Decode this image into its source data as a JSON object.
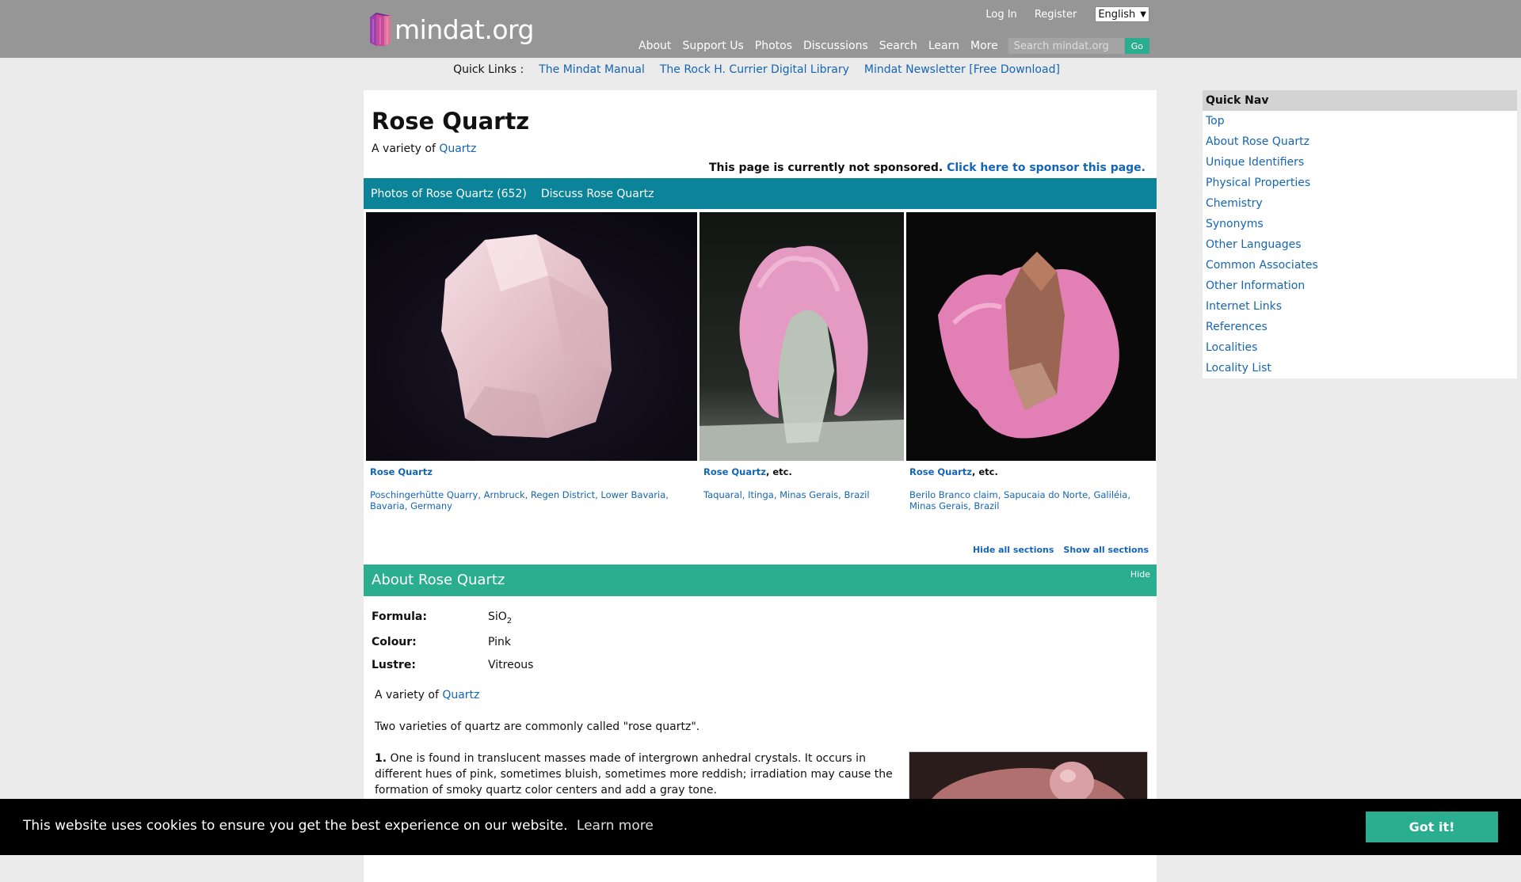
{
  "header": {
    "logo_text": "mindat.org",
    "login": "Log In",
    "register": "Register",
    "language": "English",
    "nav": [
      "About",
      "Support Us",
      "Photos",
      "Discussions",
      "Search",
      "Learn",
      "More"
    ],
    "search_placeholder": "Search mindat.org",
    "go": "Go"
  },
  "quick_links": {
    "label": "Quick Links :",
    "items": [
      "The Mindat Manual",
      "The Rock H. Currier Digital Library",
      "Mindat Newsletter [Free Download]"
    ]
  },
  "page": {
    "title": "Rose Quartz",
    "variety_prefix": "A variety of",
    "variety_link": "Quartz",
    "sponsor_text": "This page is currently not sponsored.",
    "sponsor_link": "Click here to sponsor this page.",
    "tabs": [
      "Photos of Rose Quartz (652)",
      "Discuss Rose Quartz"
    ]
  },
  "gallery": [
    {
      "name": "Rose Quartz",
      "suffix": "",
      "locality": "Poschingerhütte Quarry, Arnbruck, Regen District, Lower Bavaria, Bavaria, Germany"
    },
    {
      "name": "Rose Quartz",
      "suffix": ", etc.",
      "locality": "Taquaral, Itinga, Minas Gerais, Brazil"
    },
    {
      "name": "Rose Quartz",
      "suffix": ", etc.",
      "locality": "Berilo Branco claim, Sapucaia do Norte, Galiléia, Minas Gerais, Brazil"
    }
  ],
  "section_controls": {
    "hide_all": "Hide all sections",
    "show_all": "Show all sections"
  },
  "about": {
    "title": "About Rose Quartz",
    "hide": "Hide",
    "formula_label": "Formula:",
    "formula_base": "SiO",
    "formula_sub": "2",
    "colour_label": "Colour:",
    "colour": "Pink",
    "lustre_label": "Lustre:",
    "lustre": "Vitreous",
    "variety_prefix": "A variety of",
    "variety_link": "Quartz",
    "para1": "Two varieties of quartz are commonly called \"rose quartz\".",
    "para2_num": "1.",
    "para2": "One is found in translucent masses made of intergrown anhedral crystals. It occurs in different hues of pink, sometimes bluish, sometimes more reddish; irradiation may cause the formation of smoky quartz color centers and add a gray tone."
  },
  "quick_nav": {
    "title": "Quick Nav",
    "items": [
      "Top",
      "About Rose Quartz",
      "Unique Identifiers",
      "Physical Properties",
      "Chemistry",
      "Synonyms",
      "Other Languages",
      "Common Associates",
      "Other Information",
      "Internet Links",
      "References",
      "Localities",
      "Locality List"
    ]
  },
  "cookie": {
    "message": "This website uses cookies to ensure you get the best experience on our website.",
    "learn_more": "Learn more",
    "button": "Got it!"
  }
}
